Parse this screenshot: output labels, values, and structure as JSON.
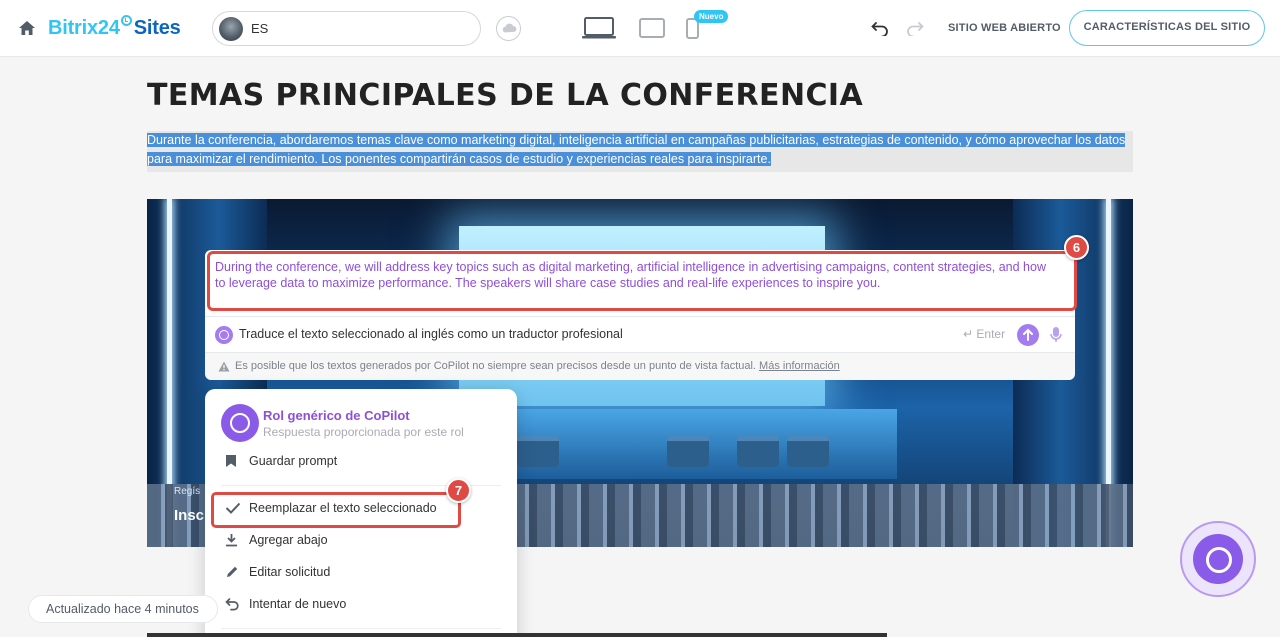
{
  "topbar": {
    "logo_main": "Bitrix24",
    "logo_sites": "Sites",
    "site_lang": "ES",
    "new_badge": "Nuevo",
    "open_site": "SITIO WEB ABIERTO",
    "features_button": "CARACTERÍSTICAS DEL SITIO"
  },
  "page": {
    "title": "TEMAS PRINCIPALES DE LA CONFERENCIA",
    "paragraph_line1": "Durante la conferencia, abordaremos temas clave como marketing digital, inteligencia artificial en campañas publicitarias, estrategias de contenido, y cómo aprovechar los datos",
    "paragraph_line2": "para maximizar el rendimiento. Los ponentes compartirán casos de estudio y experiencias reales para inspirarte.",
    "hero_small": "Regís",
    "hero_big": "Insc"
  },
  "copilot": {
    "result_text": "During the conference, we will address key topics such as digital marketing, artificial intelligence in advertising campaigns, content strategies, and how to leverage data to maximize performance. The speakers will share case studies and real-life experiences to inspire you.",
    "prompt": "Traduce el texto seleccionado al inglés como un traductor profesional",
    "enter_label": "Enter",
    "warning": "Es posible que los textos generados por CoPilot no siempre sean precisos desde un punto de vista factual.",
    "warning_link": "Más información"
  },
  "menu": {
    "role_name": "Rol genérico de CoPilot",
    "role_sub": "Respuesta proporcionada por este rol",
    "items": [
      {
        "label": "Guardar prompt",
        "icon": "bookmark-icon"
      },
      {
        "label": "Reemplazar el texto seleccionado",
        "icon": "check-icon"
      },
      {
        "label": "Agregar abajo",
        "icon": "download-icon"
      },
      {
        "label": "Editar solicitud",
        "icon": "pencil-icon"
      },
      {
        "label": "Intentar de nuevo",
        "icon": "undo-icon"
      }
    ]
  },
  "annotations": {
    "badge_6": "6",
    "badge_7": "7"
  },
  "footer": {
    "updated": "Actualizado hace 4 minutos"
  },
  "colors": {
    "accent": "#2fc6f6",
    "copilot_purple": "#8e4fd8",
    "highlight_red": "#e04a45",
    "selection_blue": "#4a8fd9"
  }
}
